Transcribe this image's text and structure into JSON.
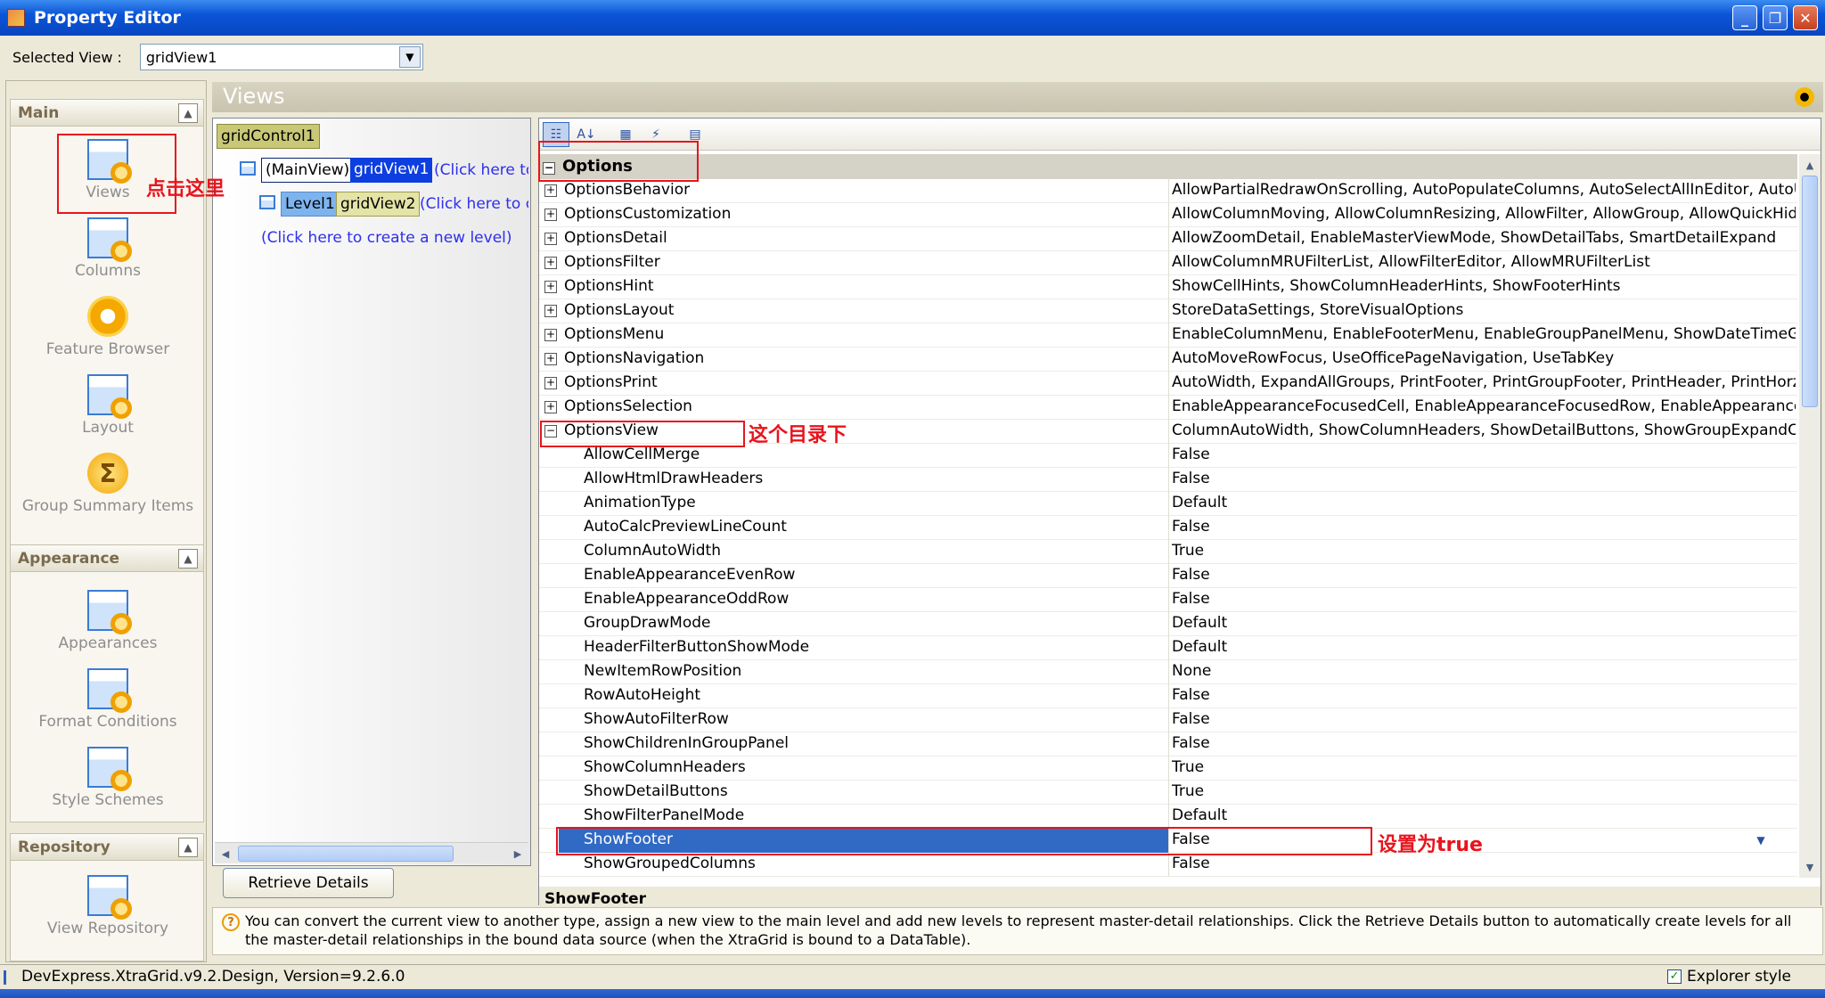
{
  "window": {
    "title": "Property Editor",
    "min_icon": "minimize-icon",
    "max_icon": "maximize-icon",
    "close_icon": "close-icon"
  },
  "selected_view": {
    "label": "Selected View :",
    "value": "gridView1"
  },
  "nav": {
    "groups": [
      {
        "title": "Main",
        "items": [
          "Views",
          "Columns",
          "Feature Browser",
          "Layout",
          "Group Summary Items"
        ]
      },
      {
        "title": "Appearance",
        "items": [
          "Appearances",
          "Format Conditions",
          "Style Schemes"
        ]
      },
      {
        "title": "Repository",
        "items": [
          "View Repository"
        ]
      }
    ]
  },
  "views_header": "Views",
  "tree": {
    "root": "gridControl1",
    "main_view": "(MainView)",
    "view1": "gridView1",
    "view1_link": "(Click here to",
    "level": "Level1",
    "view2": "gridView2",
    "view2_link": "(Click here to cl",
    "new_level": "(Click here to create a new level)"
  },
  "retrieve_button": "Retrieve Details",
  "property_grid": {
    "category": "Options",
    "groups": [
      {
        "name": "OptionsBehavior",
        "value": "AllowPartialRedrawOnScrolling, AutoPopulateColumns, AutoSelectAllInEditor, AutoUpd"
      },
      {
        "name": "OptionsCustomization",
        "value": "AllowColumnMoving, AllowColumnResizing, AllowFilter, AllowGroup, AllowQuickHideCol"
      },
      {
        "name": "OptionsDetail",
        "value": "AllowZoomDetail, EnableMasterViewMode, ShowDetailTabs, SmartDetailExpand"
      },
      {
        "name": "OptionsFilter",
        "value": "AllowColumnMRUFilterList, AllowFilterEditor, AllowMRUFilterList"
      },
      {
        "name": "OptionsHint",
        "value": "ShowCellHints, ShowColumnHeaderHints, ShowFooterHints"
      },
      {
        "name": "OptionsLayout",
        "value": "StoreDataSettings, StoreVisualOptions"
      },
      {
        "name": "OptionsMenu",
        "value": "EnableColumnMenu, EnableFooterMenu, EnableGroupPanelMenu, ShowDateTimeGrou"
      },
      {
        "name": "OptionsNavigation",
        "value": "AutoMoveRowFocus, UseOfficePageNavigation, UseTabKey"
      },
      {
        "name": "OptionsPrint",
        "value": "AutoWidth, ExpandAllGroups, PrintFooter, PrintGroupFooter, PrintHeader, PrintHorzLi"
      },
      {
        "name": "OptionsSelection",
        "value": "EnableAppearanceFocusedCell, EnableAppearanceFocusedRow, EnableAppearanceHid"
      },
      {
        "name": "OptionsView",
        "value": "ColumnAutoWidth, ShowColumnHeaders, ShowDetailButtons, ShowGroupExpandColl"
      }
    ],
    "children": [
      {
        "name": "AllowCellMerge",
        "value": "False"
      },
      {
        "name": "AllowHtmlDrawHeaders",
        "value": "False"
      },
      {
        "name": "AnimationType",
        "value": "Default"
      },
      {
        "name": "AutoCalcPreviewLineCount",
        "value": "False"
      },
      {
        "name": "ColumnAutoWidth",
        "value": "True"
      },
      {
        "name": "EnableAppearanceEvenRow",
        "value": "False"
      },
      {
        "name": "EnableAppearanceOddRow",
        "value": "False"
      },
      {
        "name": "GroupDrawMode",
        "value": "Default"
      },
      {
        "name": "HeaderFilterButtonShowMode",
        "value": "Default"
      },
      {
        "name": "NewItemRowPosition",
        "value": "None"
      },
      {
        "name": "RowAutoHeight",
        "value": "False"
      },
      {
        "name": "ShowAutoFilterRow",
        "value": "False"
      },
      {
        "name": "ShowChildrenInGroupPanel",
        "value": "False"
      },
      {
        "name": "ShowColumnHeaders",
        "value": "True"
      },
      {
        "name": "ShowDetailButtons",
        "value": "True"
      },
      {
        "name": "ShowFilterPanelMode",
        "value": "Default"
      },
      {
        "name": "ShowFooter",
        "value": "False"
      },
      {
        "name": "ShowGroupedColumns",
        "value": "False"
      }
    ],
    "description_title": "ShowFooter"
  },
  "hint": "You can convert the current view to another type, assign a new view to the main level and add new levels to represent master-detail relationships. Click the Retrieve Details button to automatically create levels for all the master-detail relationships in the bound data source (when the XtraGrid is bound to a DataTable).",
  "status": {
    "text": "DevExpress.XtraGrid.v9.2.Design, Version=9.2.6.0",
    "explorer_style": "Explorer style"
  },
  "annotations": {
    "click_here": "点击这里",
    "this_dir": "这个目录下",
    "set_true": "设置为true"
  },
  "colors": {
    "selection": "#316ac5",
    "annotation": "#e8141d",
    "title_bar": "#0a55d8"
  }
}
